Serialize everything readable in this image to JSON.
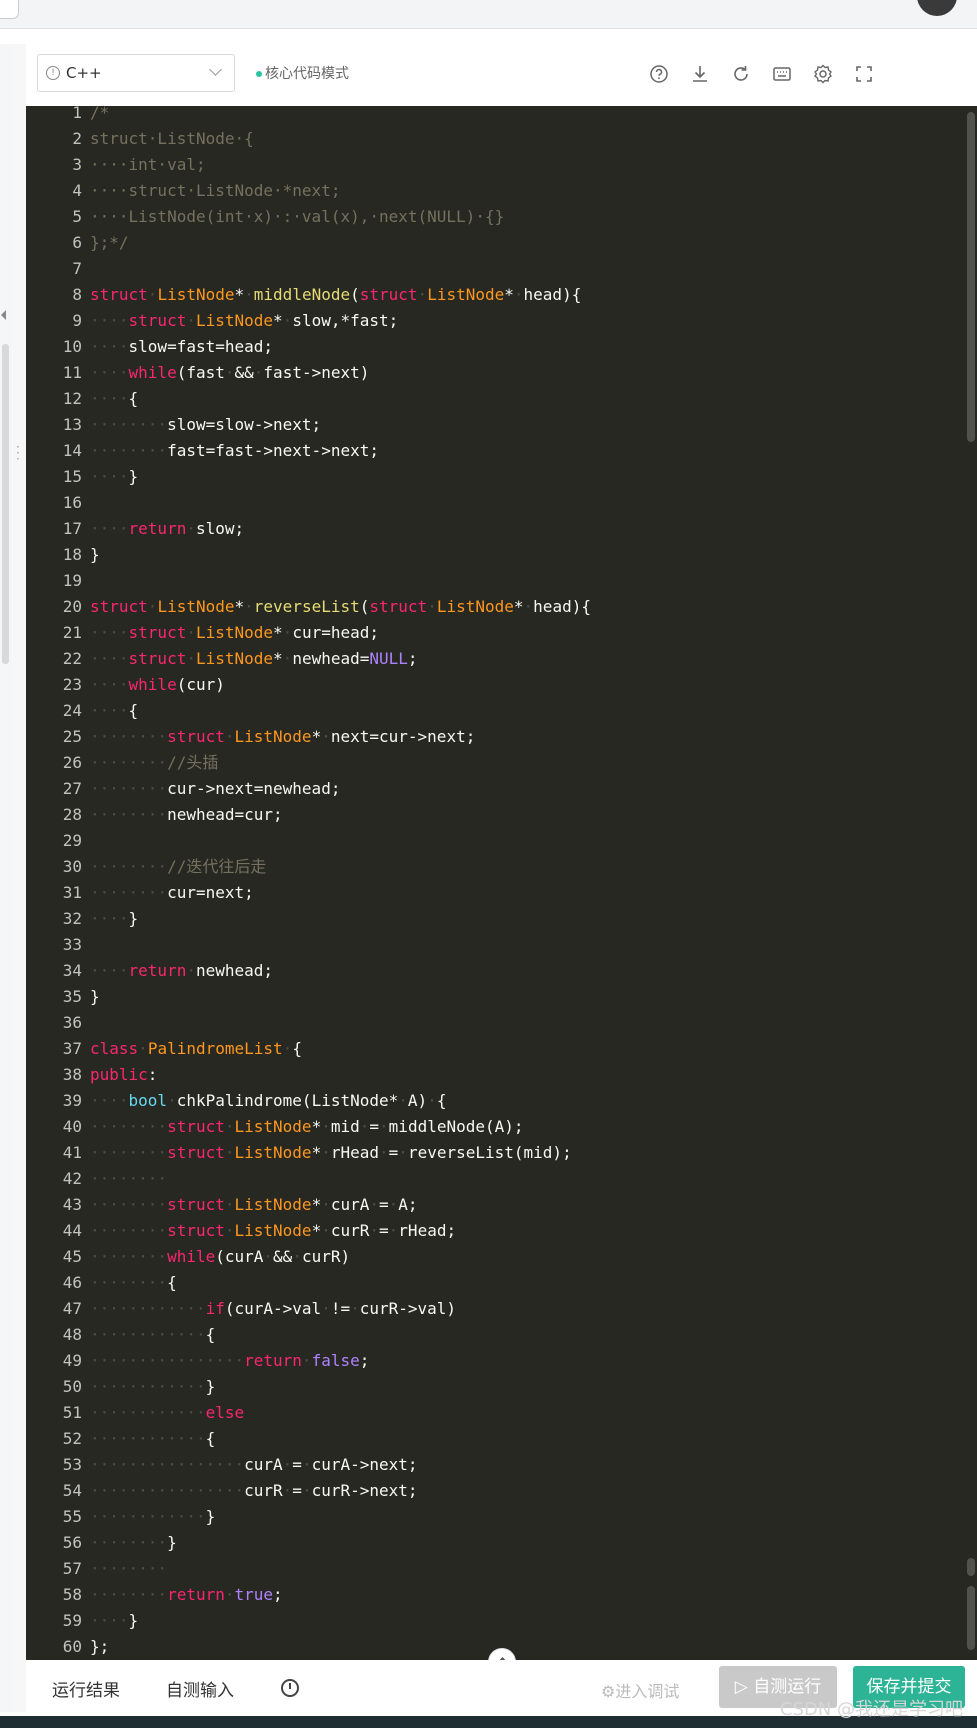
{
  "toolbar": {
    "language": "C++",
    "mode_label": "核心代码模式",
    "icons": [
      "help-icon",
      "download-icon",
      "refresh-icon",
      "keyboard-icon",
      "settings-icon",
      "fullscreen-icon"
    ]
  },
  "code_lines": [
    {
      "n": "1",
      "t": [
        [
          "c",
          "/*"
        ]
      ]
    },
    {
      "n": "2",
      "t": [
        [
          "c",
          "struct·ListNode·{"
        ]
      ]
    },
    {
      "n": "3",
      "t": [
        [
          "c",
          "····int·val;"
        ]
      ]
    },
    {
      "n": "4",
      "t": [
        [
          "c",
          "····struct·ListNode·*next;"
        ]
      ]
    },
    {
      "n": "5",
      "t": [
        [
          "c",
          "····ListNode(int·x)·:·val(x),·next(NULL)·{}"
        ]
      ]
    },
    {
      "n": "6",
      "t": [
        [
          "c",
          "};*/"
        ]
      ]
    },
    {
      "n": "7",
      "t": []
    },
    {
      "n": "8",
      "t": [
        [
          "k",
          "struct"
        ],
        [
          "d",
          "·"
        ],
        [
          "t",
          "ListNode"
        ],
        [
          "p",
          "*"
        ],
        [
          "d",
          "·"
        ],
        [
          "f",
          "middleNode"
        ],
        [
          "p",
          "("
        ],
        [
          "k",
          "struct"
        ],
        [
          "d",
          "·"
        ],
        [
          "t",
          "ListNode"
        ],
        [
          "p",
          "*"
        ],
        [
          "d",
          "·"
        ],
        [
          "p",
          "head){"
        ]
      ]
    },
    {
      "n": "9",
      "t": [
        [
          "d",
          "····"
        ],
        [
          "k",
          "struct"
        ],
        [
          "d",
          "·"
        ],
        [
          "t",
          "ListNode"
        ],
        [
          "p",
          "*"
        ],
        [
          "d",
          "·"
        ],
        [
          "p",
          "slow,*fast;"
        ]
      ]
    },
    {
      "n": "10",
      "t": [
        [
          "d",
          "····"
        ],
        [
          "p",
          "slow=fast=head;"
        ]
      ]
    },
    {
      "n": "11",
      "t": [
        [
          "d",
          "····"
        ],
        [
          "k",
          "while"
        ],
        [
          "p",
          "(fast"
        ],
        [
          "d",
          "·"
        ],
        [
          "p",
          "&&"
        ],
        [
          "d",
          "·"
        ],
        [
          "p",
          "fast->next)"
        ]
      ]
    },
    {
      "n": "12",
      "t": [
        [
          "d",
          "····"
        ],
        [
          "p",
          "{"
        ]
      ]
    },
    {
      "n": "13",
      "t": [
        [
          "d",
          "········"
        ],
        [
          "p",
          "slow=slow->next;"
        ]
      ]
    },
    {
      "n": "14",
      "t": [
        [
          "d",
          "········"
        ],
        [
          "p",
          "fast=fast->next->next;"
        ]
      ]
    },
    {
      "n": "15",
      "t": [
        [
          "d",
          "····"
        ],
        [
          "p",
          "}"
        ]
      ]
    },
    {
      "n": "16",
      "t": []
    },
    {
      "n": "17",
      "t": [
        [
          "d",
          "····"
        ],
        [
          "k",
          "return"
        ],
        [
          "d",
          "·"
        ],
        [
          "p",
          "slow;"
        ]
      ]
    },
    {
      "n": "18",
      "t": [
        [
          "p",
          "}"
        ]
      ]
    },
    {
      "n": "19",
      "t": []
    },
    {
      "n": "20",
      "t": [
        [
          "k",
          "struct"
        ],
        [
          "d",
          "·"
        ],
        [
          "t",
          "ListNode"
        ],
        [
          "p",
          "*"
        ],
        [
          "d",
          "·"
        ],
        [
          "f",
          "reverseList"
        ],
        [
          "p",
          "("
        ],
        [
          "k",
          "struct"
        ],
        [
          "d",
          "·"
        ],
        [
          "t",
          "ListNode"
        ],
        [
          "p",
          "*"
        ],
        [
          "d",
          "·"
        ],
        [
          "p",
          "head){"
        ]
      ]
    },
    {
      "n": "21",
      "t": [
        [
          "d",
          "····"
        ],
        [
          "k",
          "struct"
        ],
        [
          "d",
          "·"
        ],
        [
          "t",
          "ListNode"
        ],
        [
          "p",
          "*"
        ],
        [
          "d",
          "·"
        ],
        [
          "p",
          "cur=head;"
        ]
      ]
    },
    {
      "n": "22",
      "t": [
        [
          "d",
          "····"
        ],
        [
          "k",
          "struct"
        ],
        [
          "d",
          "·"
        ],
        [
          "t",
          "ListNode"
        ],
        [
          "p",
          "*"
        ],
        [
          "d",
          "·"
        ],
        [
          "p",
          "newhead="
        ],
        [
          "n",
          "NULL"
        ],
        [
          "p",
          ";"
        ]
      ]
    },
    {
      "n": "23",
      "t": [
        [
          "d",
          "····"
        ],
        [
          "k",
          "while"
        ],
        [
          "p",
          "(cur)"
        ]
      ]
    },
    {
      "n": "24",
      "t": [
        [
          "d",
          "····"
        ],
        [
          "p",
          "{"
        ]
      ]
    },
    {
      "n": "25",
      "t": [
        [
          "d",
          "········"
        ],
        [
          "k",
          "struct"
        ],
        [
          "d",
          "·"
        ],
        [
          "t",
          "ListNode"
        ],
        [
          "p",
          "*"
        ],
        [
          "d",
          "·"
        ],
        [
          "p",
          "next=cur->next;"
        ]
      ]
    },
    {
      "n": "26",
      "t": [
        [
          "d",
          "········"
        ],
        [
          "c",
          "//头插"
        ]
      ]
    },
    {
      "n": "27",
      "t": [
        [
          "d",
          "········"
        ],
        [
          "p",
          "cur->next=newhead;"
        ]
      ]
    },
    {
      "n": "28",
      "t": [
        [
          "d",
          "········"
        ],
        [
          "p",
          "newhead=cur;"
        ]
      ]
    },
    {
      "n": "29",
      "t": []
    },
    {
      "n": "30",
      "t": [
        [
          "d",
          "········"
        ],
        [
          "c",
          "//迭代往后走"
        ]
      ]
    },
    {
      "n": "31",
      "t": [
        [
          "d",
          "········"
        ],
        [
          "p",
          "cur=next;"
        ]
      ]
    },
    {
      "n": "32",
      "t": [
        [
          "d",
          "····"
        ],
        [
          "p",
          "}"
        ]
      ]
    },
    {
      "n": "33",
      "t": []
    },
    {
      "n": "34",
      "t": [
        [
          "d",
          "····"
        ],
        [
          "k",
          "return"
        ],
        [
          "d",
          "·"
        ],
        [
          "p",
          "newhead;"
        ]
      ]
    },
    {
      "n": "35",
      "t": [
        [
          "p",
          "}"
        ]
      ]
    },
    {
      "n": "36",
      "t": []
    },
    {
      "n": "37",
      "t": [
        [
          "k",
          "class"
        ],
        [
          "d",
          "·"
        ],
        [
          "t",
          "PalindromeList"
        ],
        [
          "d",
          "·"
        ],
        [
          "p",
          "{"
        ]
      ]
    },
    {
      "n": "38",
      "t": [
        [
          "k",
          "public"
        ],
        [
          "p",
          ":"
        ]
      ]
    },
    {
      "n": "39",
      "t": [
        [
          "d",
          "····"
        ],
        [
          "b",
          "bool"
        ],
        [
          "d",
          "·"
        ],
        [
          "p",
          "chkPalindrome(ListNode*"
        ],
        [
          "d",
          "·"
        ],
        [
          "p",
          "A)"
        ],
        [
          "d",
          "·"
        ],
        [
          "p",
          "{"
        ]
      ]
    },
    {
      "n": "40",
      "t": [
        [
          "d",
          "········"
        ],
        [
          "k",
          "struct"
        ],
        [
          "d",
          "·"
        ],
        [
          "t",
          "ListNode"
        ],
        [
          "p",
          "*"
        ],
        [
          "d",
          "·"
        ],
        [
          "p",
          "mid"
        ],
        [
          "d",
          "·"
        ],
        [
          "p",
          "="
        ],
        [
          "d",
          "·"
        ],
        [
          "p",
          "middleNode(A);"
        ]
      ]
    },
    {
      "n": "41",
      "t": [
        [
          "d",
          "········"
        ],
        [
          "k",
          "struct"
        ],
        [
          "d",
          "·"
        ],
        [
          "t",
          "ListNode"
        ],
        [
          "p",
          "*"
        ],
        [
          "d",
          "·"
        ],
        [
          "p",
          "rHead"
        ],
        [
          "d",
          "·"
        ],
        [
          "p",
          "="
        ],
        [
          "d",
          "·"
        ],
        [
          "p",
          "reverseList(mid);"
        ]
      ]
    },
    {
      "n": "42",
      "t": [
        [
          "d",
          "········"
        ]
      ]
    },
    {
      "n": "43",
      "t": [
        [
          "d",
          "········"
        ],
        [
          "k",
          "struct"
        ],
        [
          "d",
          "·"
        ],
        [
          "t",
          "ListNode"
        ],
        [
          "p",
          "*"
        ],
        [
          "d",
          "·"
        ],
        [
          "p",
          "curA"
        ],
        [
          "d",
          "·"
        ],
        [
          "p",
          "="
        ],
        [
          "d",
          "·"
        ],
        [
          "p",
          "A;"
        ]
      ]
    },
    {
      "n": "44",
      "t": [
        [
          "d",
          "········"
        ],
        [
          "k",
          "struct"
        ],
        [
          "d",
          "·"
        ],
        [
          "t",
          "ListNode"
        ],
        [
          "p",
          "*"
        ],
        [
          "d",
          "·"
        ],
        [
          "p",
          "curR"
        ],
        [
          "d",
          "·"
        ],
        [
          "p",
          "="
        ],
        [
          "d",
          "·"
        ],
        [
          "p",
          "rHead;"
        ]
      ]
    },
    {
      "n": "45",
      "t": [
        [
          "d",
          "········"
        ],
        [
          "k",
          "while"
        ],
        [
          "p",
          "(curA"
        ],
        [
          "d",
          "·"
        ],
        [
          "p",
          "&&"
        ],
        [
          "d",
          "·"
        ],
        [
          "p",
          "curR)"
        ]
      ]
    },
    {
      "n": "46",
      "t": [
        [
          "d",
          "········"
        ],
        [
          "p",
          "{"
        ]
      ]
    },
    {
      "n": "47",
      "t": [
        [
          "d",
          "············"
        ],
        [
          "k",
          "if"
        ],
        [
          "p",
          "(curA->val"
        ],
        [
          "d",
          "·"
        ],
        [
          "p",
          "!="
        ],
        [
          "d",
          "·"
        ],
        [
          "p",
          "curR->val)"
        ]
      ]
    },
    {
      "n": "48",
      "t": [
        [
          "d",
          "············"
        ],
        [
          "p",
          "{"
        ]
      ]
    },
    {
      "n": "49",
      "t": [
        [
          "d",
          "················"
        ],
        [
          "k",
          "return"
        ],
        [
          "d",
          "·"
        ],
        [
          "n",
          "false"
        ],
        [
          "p",
          ";"
        ]
      ]
    },
    {
      "n": "50",
      "t": [
        [
          "d",
          "············"
        ],
        [
          "p",
          "}"
        ]
      ]
    },
    {
      "n": "51",
      "t": [
        [
          "d",
          "············"
        ],
        [
          "k",
          "else"
        ]
      ]
    },
    {
      "n": "52",
      "t": [
        [
          "d",
          "············"
        ],
        [
          "p",
          "{"
        ]
      ]
    },
    {
      "n": "53",
      "t": [
        [
          "d",
          "················"
        ],
        [
          "p",
          "curA"
        ],
        [
          "d",
          "·"
        ],
        [
          "p",
          "="
        ],
        [
          "d",
          "·"
        ],
        [
          "p",
          "curA->next;"
        ]
      ]
    },
    {
      "n": "54",
      "t": [
        [
          "d",
          "················"
        ],
        [
          "p",
          "curR"
        ],
        [
          "d",
          "·"
        ],
        [
          "p",
          "="
        ],
        [
          "d",
          "·"
        ],
        [
          "p",
          "curR->next;"
        ]
      ]
    },
    {
      "n": "55",
      "t": [
        [
          "d",
          "············"
        ],
        [
          "p",
          "}"
        ]
      ]
    },
    {
      "n": "56",
      "t": [
        [
          "d",
          "········"
        ],
        [
          "p",
          "}"
        ]
      ]
    },
    {
      "n": "57",
      "t": [
        [
          "d",
          "········"
        ]
      ]
    },
    {
      "n": "58",
      "t": [
        [
          "d",
          "········"
        ],
        [
          "k",
          "return"
        ],
        [
          "d",
          "·"
        ],
        [
          "n",
          "true"
        ],
        [
          "p",
          ";"
        ]
      ]
    },
    {
      "n": "59",
      "t": [
        [
          "d",
          "····"
        ],
        [
          "p",
          "}"
        ]
      ]
    },
    {
      "n": "60",
      "t": [
        [
          "p",
          "};"
        ]
      ]
    }
  ],
  "bottom": {
    "tab_results": "运行结果",
    "tab_input": "自测输入",
    "debug_label": "进入调试",
    "run_label": "自测运行",
    "submit_label": "保存并提交"
  },
  "watermark": "CSDN @我还是学习吧"
}
